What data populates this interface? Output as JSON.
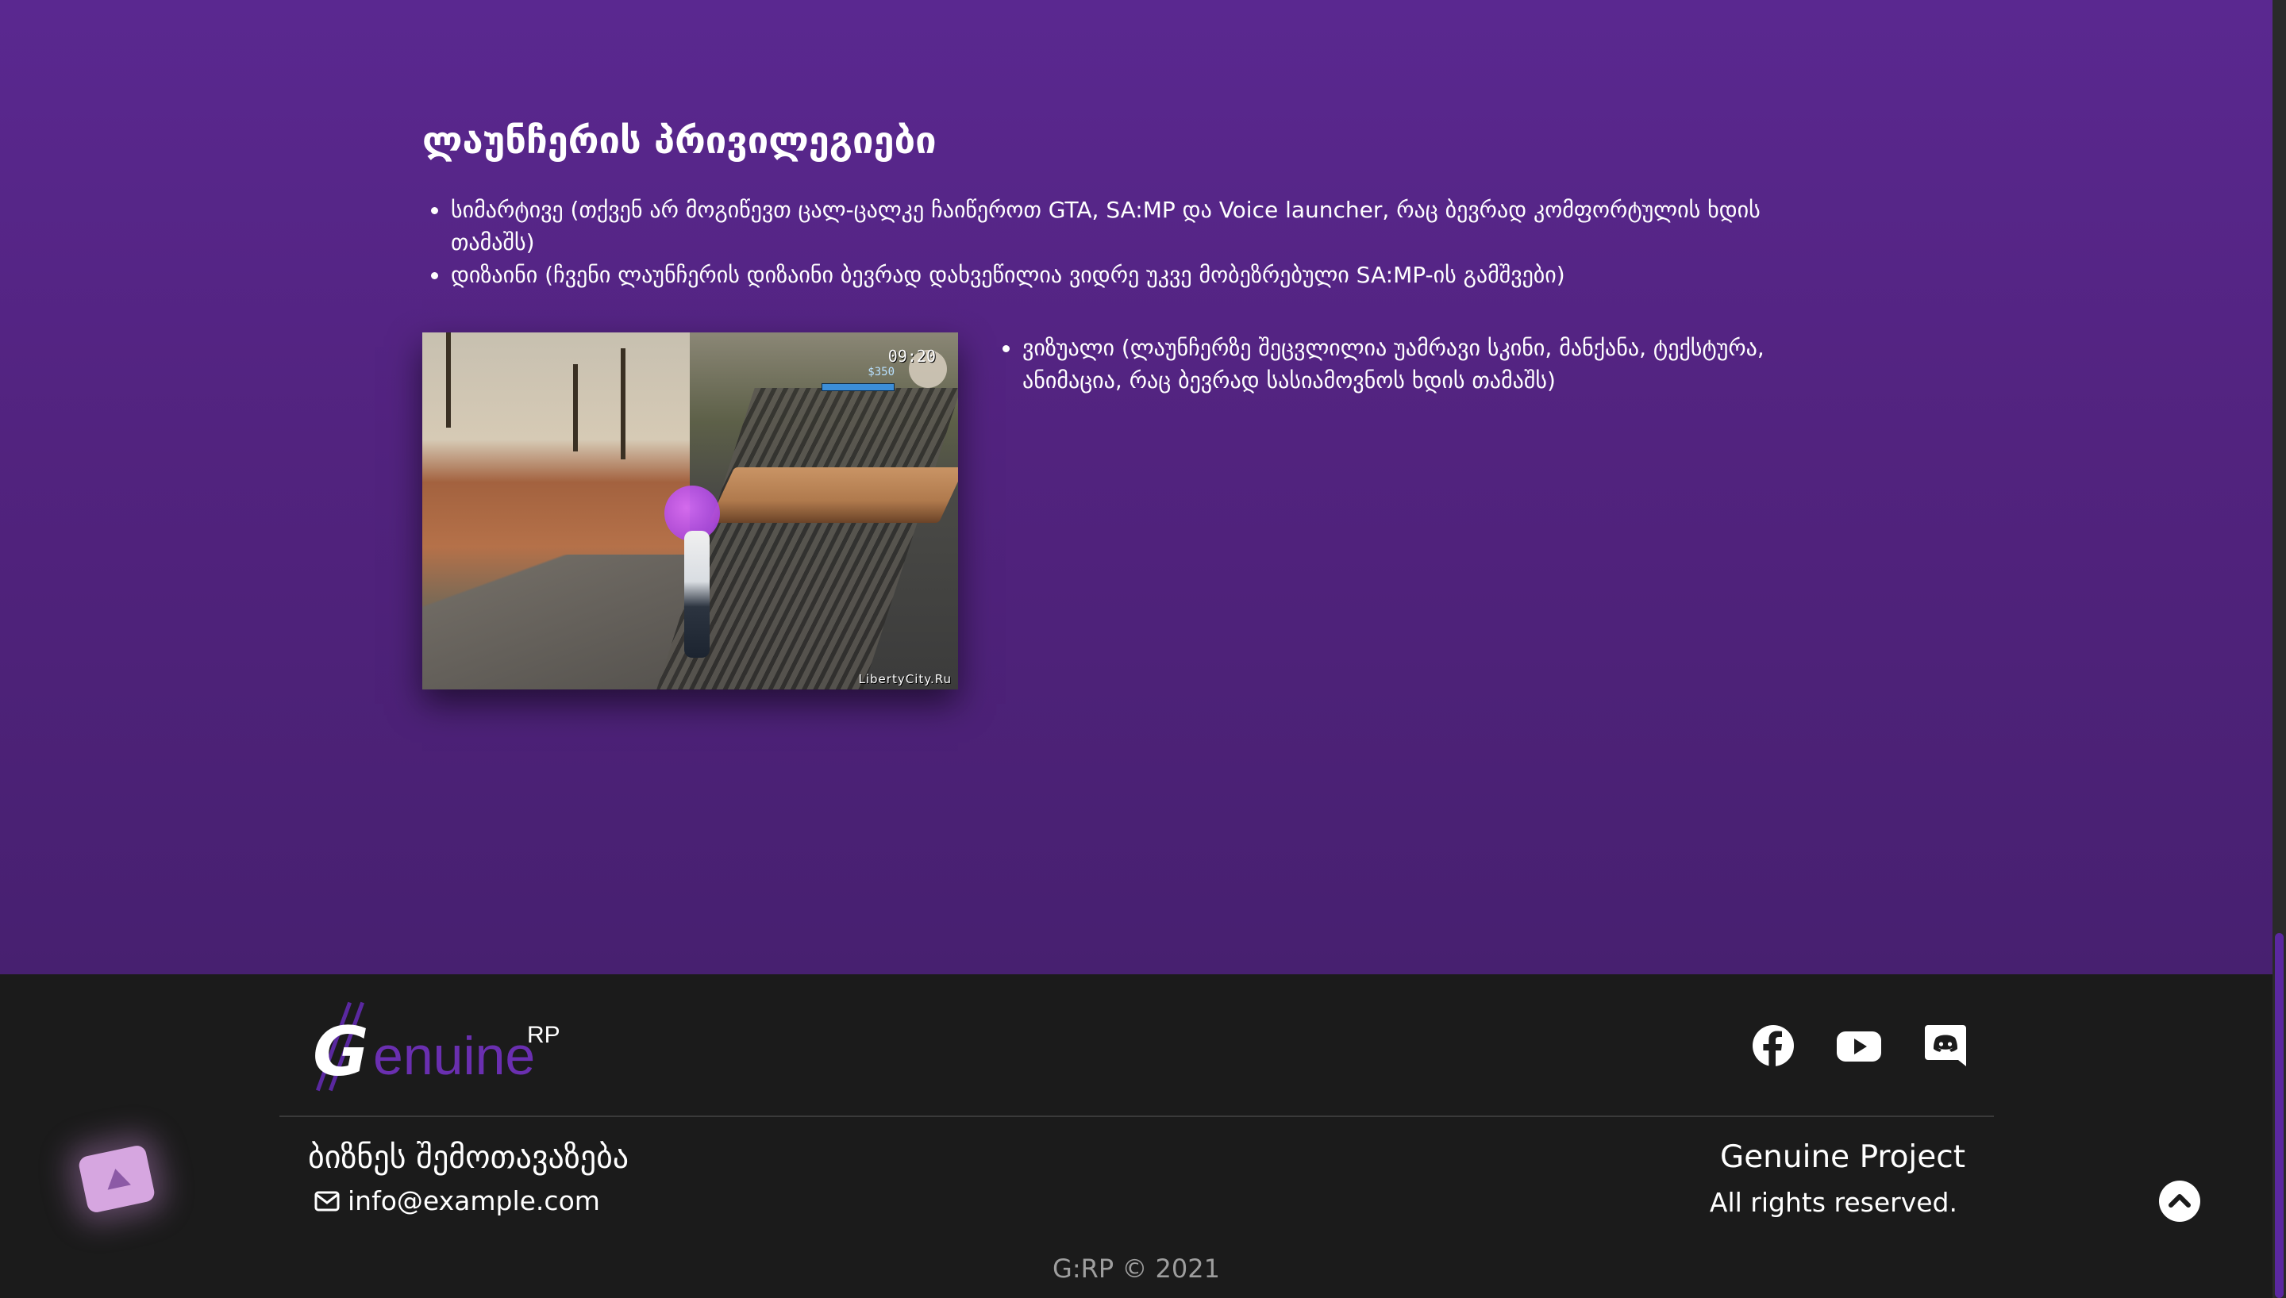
{
  "privileges": {
    "title": "ლაუნჩერის პრივილეგიები",
    "items": [
      "სიმარტივე (თქვენ არ მოგიწევთ ცალ-ცალკე ჩაიწეროთ GTA, SA:MP და Voice launcher, რაც ბევრად კომფორტულის ხდის თამაშს)",
      "დიზაინი (ჩვენი ლაუნჩერის დიზაინი ბევრად დახვეწილია ვიდრე უკვე მობეზრებული SA:MP-ის გამშვები)"
    ],
    "visual_item": "ვიზუალი (ლაუნჩერზე შეცვლილია უამრავი სკინი, მანქანა, ტექსტურა, ანიმაცია, რაც ბევრად სასიამოვნოს ხდის თამაშს)"
  },
  "screenshot": {
    "hud_time": "09:20",
    "hud_money": "$350",
    "watermark": "LibertyCity.Ru"
  },
  "footer": {
    "logo": {
      "letter": "G",
      "word": "enuine",
      "superscript": "RP"
    },
    "social": [
      {
        "icon": "facebook-icon"
      },
      {
        "icon": "youtube-icon"
      },
      {
        "icon": "discord-icon"
      }
    ],
    "business_title": "ბიზნეს შემოთავაზება",
    "email": "info@example.com",
    "project_name": "Genuine Project",
    "rights": "All rights reserved.",
    "copyright": "G:RP © 2021"
  },
  "colors": {
    "accent_purple": "#5a2890",
    "footer_bg": "#1b1b1b",
    "logo_purple": "#6a2fb0"
  }
}
